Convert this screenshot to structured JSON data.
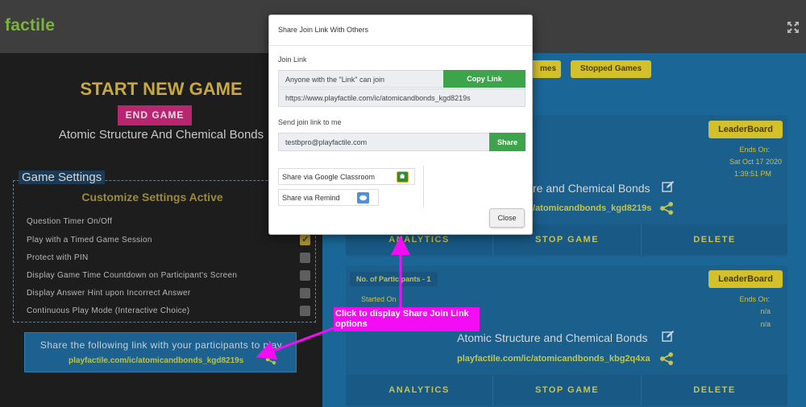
{
  "app": {
    "logo": "factile"
  },
  "left": {
    "start_title": "START NEW GAME",
    "end_game_label": "END GAME",
    "game_name": "Atomic Structure And Chemical Bonds",
    "settings_title": "Game Settings",
    "customize_title": "Customize Settings Active",
    "settings": [
      {
        "label": "Question Timer On/Off",
        "checked": false,
        "has_checkbox": false
      },
      {
        "label": "Play with a Timed Game Session",
        "checked": true,
        "has_checkbox": true
      },
      {
        "label": "Protect with PIN",
        "checked": false,
        "has_checkbox": true
      },
      {
        "label": "Display Game Time Countdown on Participant's Screen",
        "checked": false,
        "has_checkbox": true
      },
      {
        "label": "Display Answer Hint upon Incorrect Answer",
        "checked": false,
        "has_checkbox": true
      },
      {
        "label": "Continuous Play Mode (Interactive Choice)",
        "checked": false,
        "has_checkbox": true
      }
    ],
    "share_caption": "Share the following link with your participants to play",
    "share_link": "playfactile.com/ic/atomicandbonds_kgd8219s"
  },
  "right": {
    "tabs": {
      "games_partial": "mes",
      "stopped": "Stopped Games"
    },
    "card1": {
      "leaderboard": "LeaderBoard",
      "ends_label": "Ends On:",
      "ends_date": "Sat Oct 17 2020",
      "ends_time": "1:39:51 PM",
      "title_partial": "re and Chemical Bonds",
      "link_partial": "/atomicandbonds_kgd8219s",
      "actions": {
        "analytics": "ANALYTICS",
        "stop": "STOP GAME",
        "delete": "DELETE"
      }
    },
    "card2": {
      "participants": "No. of Participants - 1",
      "leaderboard": "LeaderBoard",
      "started_label": "Started On",
      "ends_label": "Ends On:",
      "ends_val1": "n/a",
      "ends_val2": "n/a",
      "title": "Atomic Structure and Chemical Bonds",
      "link": "playfactile.com/ic/atomicandbonds_kbg2q4xa",
      "actions": {
        "analytics": "ANALYTICS",
        "stop": "STOP GAME",
        "delete": "DELETE"
      }
    }
  },
  "modal": {
    "title": "Share Join Link With Others",
    "join_link_label": "Join Link",
    "anyone_text": "Anyone with the \"Link\" can join",
    "copy_link_label": "Copy Link",
    "join_url": "https://www.playfactile.com/ic/atomicandbonds_kgd8219s",
    "send_label": "Send join link to me",
    "email_value": "testbpro@playfactile.com",
    "share_label": "Share",
    "share_google": "Share via Google Classroom",
    "share_remind": "Share via Remind",
    "close_label": "Close"
  },
  "annotation": {
    "text": "Click to display Share Join Link options"
  },
  "colors": {
    "accent_green": "#3ea44b",
    "annotation_magenta": "#f40df4",
    "gold": "#c9a93d",
    "panel_blue": "#1a6696"
  }
}
